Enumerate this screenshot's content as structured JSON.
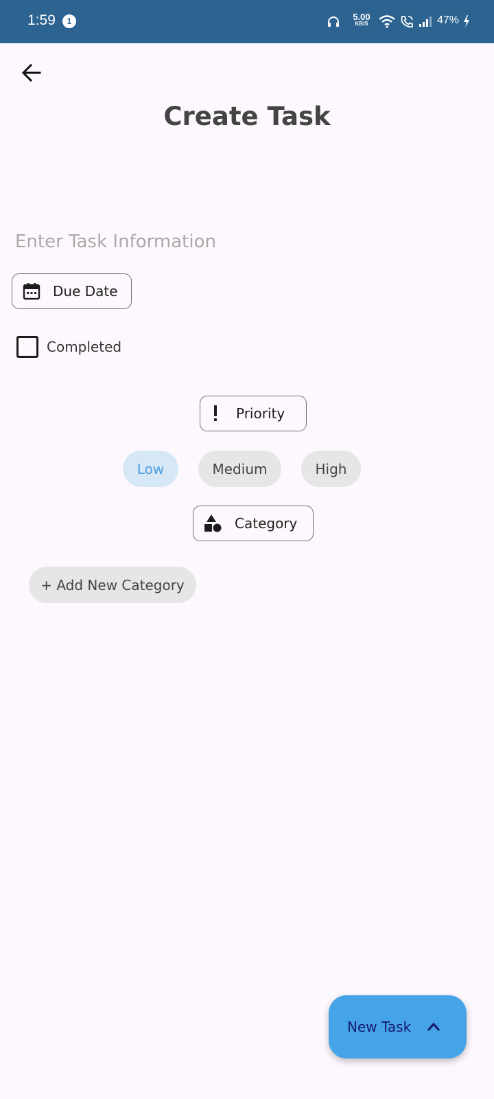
{
  "status_bar": {
    "time": "1:59",
    "notification_count": "1",
    "net_speed_value": "5.00",
    "net_speed_unit": "KB/S",
    "battery": "47%"
  },
  "header": {
    "title": "Create Task",
    "back_icon": "arrow-left-icon"
  },
  "form": {
    "task_input": {
      "placeholder": "Enter Task Information",
      "value": ""
    },
    "due_date_label": "Due Date",
    "completed_label": "Completed",
    "completed_checked": false,
    "priority_label": "Priority",
    "priority_options": [
      "Low",
      "Medium",
      "High"
    ],
    "priority_selected": "Low",
    "category_label": "Category",
    "add_category_label": "+ Add New Category"
  },
  "fab": {
    "label": "New Task",
    "icon": "chevron-up-icon"
  },
  "colors": {
    "status_bar": "#2c6390",
    "background": "#fdf8fd",
    "accent": "#45a3e8",
    "chip_selected_bg": "#d6e7f6",
    "chip_selected_text": "#4d9ee0",
    "chip_bg": "#e6e6e6"
  }
}
